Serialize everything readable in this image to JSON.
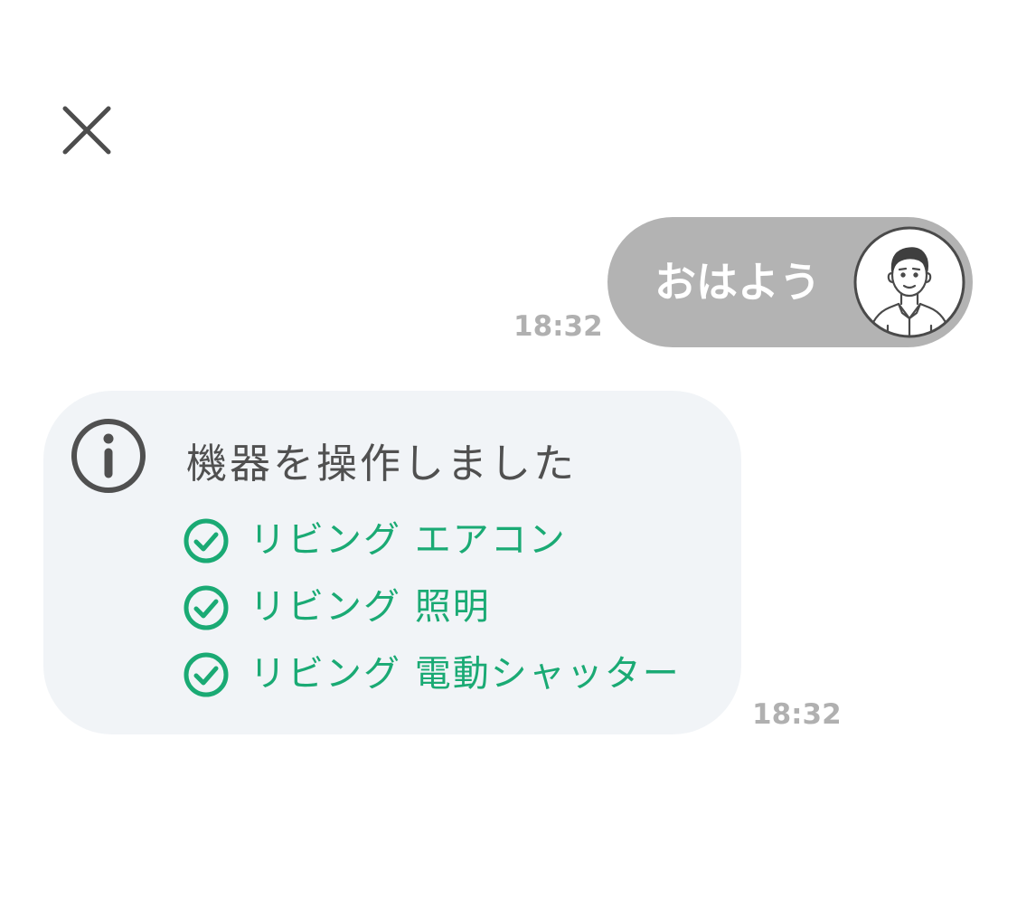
{
  "header": {
    "close_icon": "close-icon"
  },
  "messages": {
    "user": {
      "text": "おはよう",
      "time": "18:32",
      "avatar_icon": "user-avatar-icon",
      "bubble_color": "#b3b3b3"
    },
    "system": {
      "icon": "info-icon",
      "title": "機器を操作しました",
      "time": "18:32",
      "card_color": "#f1f4f7",
      "accent_color": "#1aaa74",
      "items": [
        {
          "icon": "check-circle-icon",
          "label": "リビング エアコン"
        },
        {
          "icon": "check-circle-icon",
          "label": "リビング 照明"
        },
        {
          "icon": "check-circle-icon",
          "label": "リビング 電動シャッター"
        }
      ]
    }
  }
}
